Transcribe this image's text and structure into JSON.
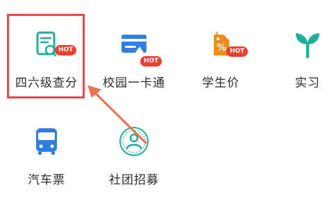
{
  "grid": {
    "items": [
      {
        "label": "四六级查分",
        "badge": "HOT",
        "icon": "score-report-icon",
        "color": "#1fae9a"
      },
      {
        "label": "校园一卡通",
        "badge": "HOT",
        "icon": "campus-card-icon",
        "color": "#2e7fe0"
      },
      {
        "label": "学生价",
        "badge": "HOT",
        "icon": "price-tag-percent-icon",
        "color": "#f28a1d"
      },
      {
        "label": "实习",
        "badge": "",
        "icon": "sprout-icon",
        "color": "#1fae9a"
      },
      {
        "label": "汽车票",
        "badge": "",
        "icon": "bus-icon",
        "color": "#2e7fe0"
      },
      {
        "label": "社团招募",
        "badge": "",
        "icon": "club-person-icon",
        "color": "#1fae9a"
      }
    ]
  },
  "annotation": {
    "highlight_color": "#e14a4a",
    "arrow_color": "#e8714f"
  }
}
